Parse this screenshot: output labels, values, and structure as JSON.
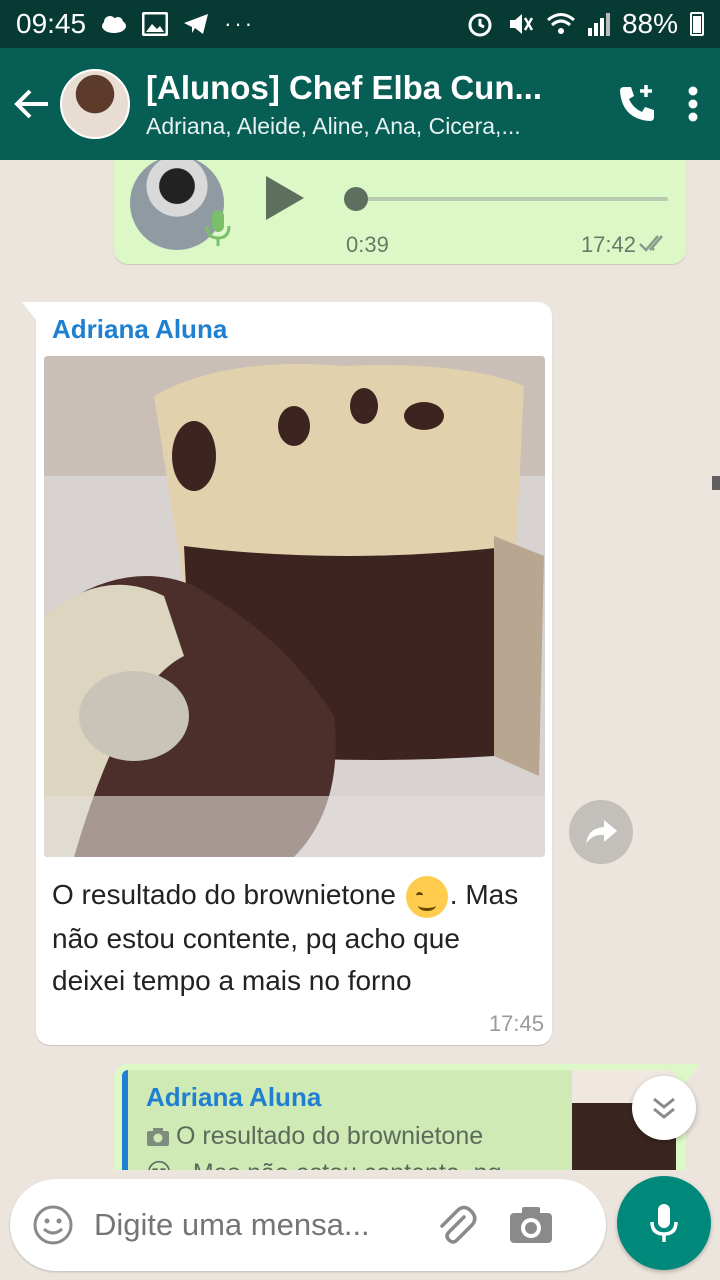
{
  "status_bar": {
    "time": "09:45",
    "battery": "88%",
    "icons": [
      "cloud-icon",
      "image-icon",
      "telegram-icon",
      "more-dots-icon",
      "alarm-icon",
      "mute-icon",
      "wifi-icon",
      "signal-icon",
      "battery-icon"
    ]
  },
  "header": {
    "title": "[Alunos] Chef Elba Cun...",
    "subtitle": "Adriana, Aleide, Aline, Ana, Cicera,..."
  },
  "messages": {
    "audio": {
      "duration": "0:39",
      "time": "17:42",
      "progress": 0
    },
    "photo": {
      "sender": "Adriana Aluna",
      "caption_part1": "O resultado do brownietone ",
      "caption_part2": ". Mas não estou contente,  pq acho que deixei tempo a mais no forno",
      "emoji": "smirking-face",
      "time": "17:45"
    },
    "reply": {
      "quoted_sender": "Adriana Aluna",
      "quoted_text": "O resultado do brownietone",
      "quoted_text_line2": "😏 . Mas não estou contente,  pq"
    }
  },
  "composer": {
    "placeholder": "Digite uma mensa..."
  },
  "colors": {
    "appbar": "#075e54",
    "statusbar": "#073a33",
    "outgoing_bubble": "#dcf8c6",
    "incoming_bubble": "#ffffff",
    "sender_name": "#1f7fd1",
    "mic_button": "#00897b"
  }
}
